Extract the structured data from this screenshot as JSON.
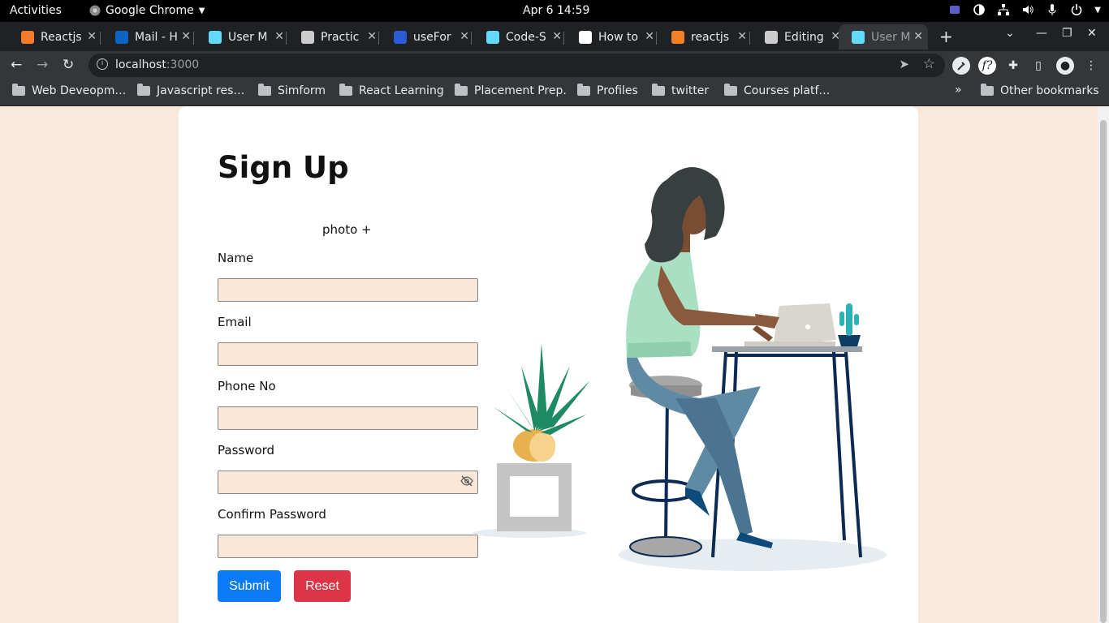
{
  "system": {
    "activities": "Activities",
    "app_name": "Google Chrome",
    "clock": "Apr 6  14:59"
  },
  "tabs": [
    {
      "label": "Reactjs",
      "color": "#f47c2a"
    },
    {
      "label": "Mail - H",
      "color": "#0a66c2"
    },
    {
      "label": "User M",
      "color": "#61dafb"
    },
    {
      "label": "Practic",
      "color": "#cccccc"
    },
    {
      "label": "useFor",
      "color": "#2b5bd7"
    },
    {
      "label": "Code-S",
      "color": "#61dafb"
    },
    {
      "label": "How to",
      "color": "#ffffff"
    },
    {
      "label": "reactjs",
      "color": "#f48024"
    },
    {
      "label": "Editing",
      "color": "#cccccc"
    },
    {
      "label": "User M",
      "color": "#61dafb",
      "active": true
    }
  ],
  "address": {
    "host": "localhost",
    "port": ":3000"
  },
  "bookmarks": [
    "Web Deveopm…",
    "Javascript res…",
    "Simform",
    "React Learning",
    "Placement Prep.",
    "Profiles",
    "twitter",
    "Courses platf…"
  ],
  "other_bookmarks": "Other bookmarks",
  "form": {
    "title": "Sign Up",
    "photo_label": "photo +",
    "fields": [
      {
        "label": "Name",
        "value": ""
      },
      {
        "label": "Email",
        "value": ""
      },
      {
        "label": "Phone No",
        "value": ""
      },
      {
        "label": "Password",
        "value": ""
      },
      {
        "label": "Confirm Password",
        "value": ""
      }
    ],
    "submit": "Submit",
    "reset": "Reset"
  },
  "colors": {
    "page_bg": "#f9e9da",
    "input_bg": "#f9e6d6",
    "submit": "#0b7bf5",
    "reset": "#dc3548"
  }
}
